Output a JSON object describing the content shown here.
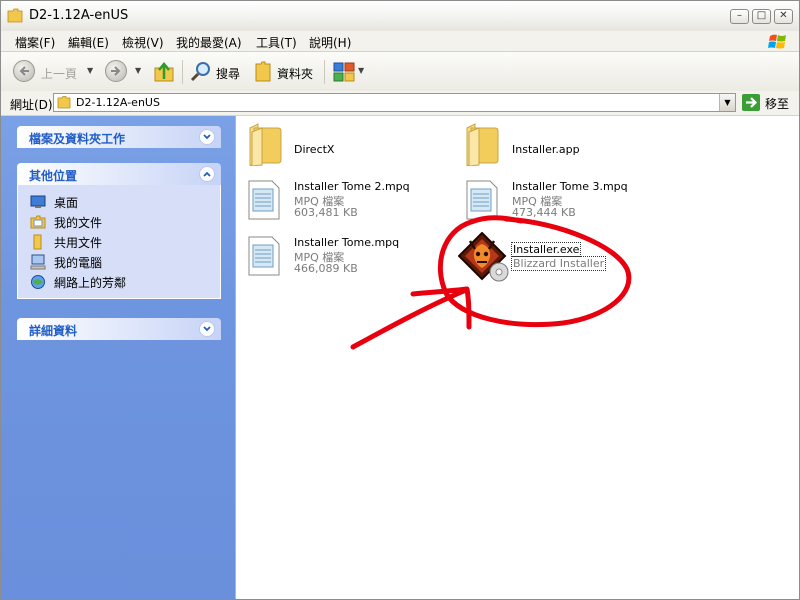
{
  "window": {
    "title": "D2-1.12A-enUS"
  },
  "title_buttons": {
    "minimize": "–",
    "maximize": "□",
    "close": "✕"
  },
  "menu": [
    "檔案(F)",
    "編輯(E)",
    "檢視(V)",
    "我的最愛(A)",
    "工具(T)",
    "說明(H)"
  ],
  "toolbar": {
    "back_label": "上一頁",
    "search_label": "搜尋",
    "folders_label": "資料夾"
  },
  "address": {
    "label": "網址(D)",
    "value": "D2-1.12A-enUS",
    "go_label": "移至"
  },
  "left_pane": {
    "tasks_title": "檔案及資料夾工作",
    "other_places_title": "其他位置",
    "other_places": [
      {
        "label": "桌面",
        "icon": "desktop-icon"
      },
      {
        "label": "我的文件",
        "icon": "my-documents-icon"
      },
      {
        "label": "共用文件",
        "icon": "shared-documents-icon"
      },
      {
        "label": "我的電腦",
        "icon": "my-computer-icon"
      },
      {
        "label": "網路上的芳鄰",
        "icon": "network-places-icon"
      }
    ],
    "details_title": "詳細資料"
  },
  "files": [
    {
      "name": "DirectX",
      "type": "",
      "size": "",
      "icon": "folder-icon"
    },
    {
      "name": "Installer.app",
      "type": "",
      "size": "",
      "icon": "folder-icon"
    },
    {
      "name": "Installer Tome 2.mpq",
      "type": "MPQ 檔案",
      "size": "603,481 KB",
      "icon": "mpq-file-icon"
    },
    {
      "name": "Installer Tome 3.mpq",
      "type": "MPQ 檔案",
      "size": "473,444 KB",
      "icon": "mpq-file-icon"
    },
    {
      "name": "Installer Tome.mpq",
      "type": "MPQ 檔案",
      "size": "466,089 KB",
      "icon": "mpq-file-icon"
    },
    {
      "name": "Installer.exe",
      "type": "Blizzard Installer",
      "size": "",
      "icon": "diablo-installer-icon",
      "selected": true
    }
  ],
  "colors": {
    "left_pane": "#6e95df",
    "panel_title": "#215dc6",
    "annotation": "#e8000e"
  }
}
